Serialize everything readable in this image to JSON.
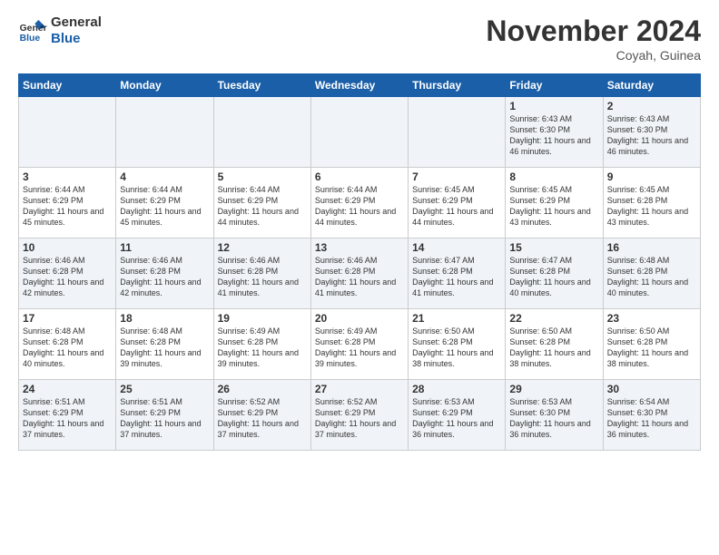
{
  "app": {
    "logo_line1": "General",
    "logo_line2": "Blue"
  },
  "header": {
    "title": "November 2024",
    "location": "Coyah, Guinea"
  },
  "weekdays": [
    "Sunday",
    "Monday",
    "Tuesday",
    "Wednesday",
    "Thursday",
    "Friday",
    "Saturday"
  ],
  "weeks": [
    [
      {
        "day": "",
        "info": ""
      },
      {
        "day": "",
        "info": ""
      },
      {
        "day": "",
        "info": ""
      },
      {
        "day": "",
        "info": ""
      },
      {
        "day": "",
        "info": ""
      },
      {
        "day": "1",
        "info": "Sunrise: 6:43 AM\nSunset: 6:30 PM\nDaylight: 11 hours and 46 minutes."
      },
      {
        "day": "2",
        "info": "Sunrise: 6:43 AM\nSunset: 6:30 PM\nDaylight: 11 hours and 46 minutes."
      }
    ],
    [
      {
        "day": "3",
        "info": "Sunrise: 6:44 AM\nSunset: 6:29 PM\nDaylight: 11 hours and 45 minutes."
      },
      {
        "day": "4",
        "info": "Sunrise: 6:44 AM\nSunset: 6:29 PM\nDaylight: 11 hours and 45 minutes."
      },
      {
        "day": "5",
        "info": "Sunrise: 6:44 AM\nSunset: 6:29 PM\nDaylight: 11 hours and 44 minutes."
      },
      {
        "day": "6",
        "info": "Sunrise: 6:44 AM\nSunset: 6:29 PM\nDaylight: 11 hours and 44 minutes."
      },
      {
        "day": "7",
        "info": "Sunrise: 6:45 AM\nSunset: 6:29 PM\nDaylight: 11 hours and 44 minutes."
      },
      {
        "day": "8",
        "info": "Sunrise: 6:45 AM\nSunset: 6:29 PM\nDaylight: 11 hours and 43 minutes."
      },
      {
        "day": "9",
        "info": "Sunrise: 6:45 AM\nSunset: 6:28 PM\nDaylight: 11 hours and 43 minutes."
      }
    ],
    [
      {
        "day": "10",
        "info": "Sunrise: 6:46 AM\nSunset: 6:28 PM\nDaylight: 11 hours and 42 minutes."
      },
      {
        "day": "11",
        "info": "Sunrise: 6:46 AM\nSunset: 6:28 PM\nDaylight: 11 hours and 42 minutes."
      },
      {
        "day": "12",
        "info": "Sunrise: 6:46 AM\nSunset: 6:28 PM\nDaylight: 11 hours and 41 minutes."
      },
      {
        "day": "13",
        "info": "Sunrise: 6:46 AM\nSunset: 6:28 PM\nDaylight: 11 hours and 41 minutes."
      },
      {
        "day": "14",
        "info": "Sunrise: 6:47 AM\nSunset: 6:28 PM\nDaylight: 11 hours and 41 minutes."
      },
      {
        "day": "15",
        "info": "Sunrise: 6:47 AM\nSunset: 6:28 PM\nDaylight: 11 hours and 40 minutes."
      },
      {
        "day": "16",
        "info": "Sunrise: 6:48 AM\nSunset: 6:28 PM\nDaylight: 11 hours and 40 minutes."
      }
    ],
    [
      {
        "day": "17",
        "info": "Sunrise: 6:48 AM\nSunset: 6:28 PM\nDaylight: 11 hours and 40 minutes."
      },
      {
        "day": "18",
        "info": "Sunrise: 6:48 AM\nSunset: 6:28 PM\nDaylight: 11 hours and 39 minutes."
      },
      {
        "day": "19",
        "info": "Sunrise: 6:49 AM\nSunset: 6:28 PM\nDaylight: 11 hours and 39 minutes."
      },
      {
        "day": "20",
        "info": "Sunrise: 6:49 AM\nSunset: 6:28 PM\nDaylight: 11 hours and 39 minutes."
      },
      {
        "day": "21",
        "info": "Sunrise: 6:50 AM\nSunset: 6:28 PM\nDaylight: 11 hours and 38 minutes."
      },
      {
        "day": "22",
        "info": "Sunrise: 6:50 AM\nSunset: 6:28 PM\nDaylight: 11 hours and 38 minutes."
      },
      {
        "day": "23",
        "info": "Sunrise: 6:50 AM\nSunset: 6:28 PM\nDaylight: 11 hours and 38 minutes."
      }
    ],
    [
      {
        "day": "24",
        "info": "Sunrise: 6:51 AM\nSunset: 6:29 PM\nDaylight: 11 hours and 37 minutes."
      },
      {
        "day": "25",
        "info": "Sunrise: 6:51 AM\nSunset: 6:29 PM\nDaylight: 11 hours and 37 minutes."
      },
      {
        "day": "26",
        "info": "Sunrise: 6:52 AM\nSunset: 6:29 PM\nDaylight: 11 hours and 37 minutes."
      },
      {
        "day": "27",
        "info": "Sunrise: 6:52 AM\nSunset: 6:29 PM\nDaylight: 11 hours and 37 minutes."
      },
      {
        "day": "28",
        "info": "Sunrise: 6:53 AM\nSunset: 6:29 PM\nDaylight: 11 hours and 36 minutes."
      },
      {
        "day": "29",
        "info": "Sunrise: 6:53 AM\nSunset: 6:30 PM\nDaylight: 11 hours and 36 minutes."
      },
      {
        "day": "30",
        "info": "Sunrise: 6:54 AM\nSunset: 6:30 PM\nDaylight: 11 hours and 36 minutes."
      }
    ]
  ]
}
